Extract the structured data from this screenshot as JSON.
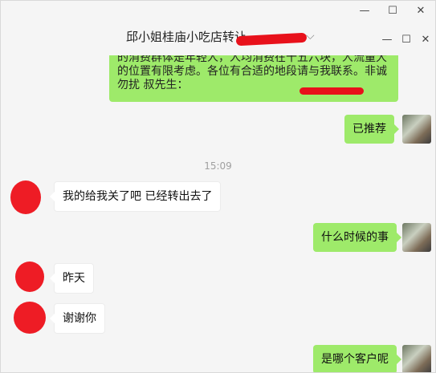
{
  "window_controls": {
    "outer": {
      "minimize": "—",
      "maximize": "☐",
      "close": "✕"
    },
    "inner": {
      "minimize": "—",
      "maximize": "☐",
      "close": "✕"
    }
  },
  "chat": {
    "title": "邱小姐桂庙小吃店转让",
    "messages": [
      {
        "side": "me",
        "text_lines": [
          "的消费群体是年轻人，人均消费在十五六块，人流量大",
          "的位置有限考虑。各位有合适的地段请与我联系。非诚",
          "勿扰 叔先生："
        ]
      },
      {
        "side": "me",
        "text": "已推荐"
      },
      {
        "type": "timestamp",
        "text": "15:09"
      },
      {
        "side": "other",
        "text": "我的给我关了吧 已经转出去了"
      },
      {
        "side": "me",
        "text": "什么时候的事"
      },
      {
        "side": "other",
        "text": "昨天"
      },
      {
        "side": "other",
        "text": "谢谢你"
      },
      {
        "side": "me",
        "text": "是哪个客户呢"
      }
    ]
  }
}
